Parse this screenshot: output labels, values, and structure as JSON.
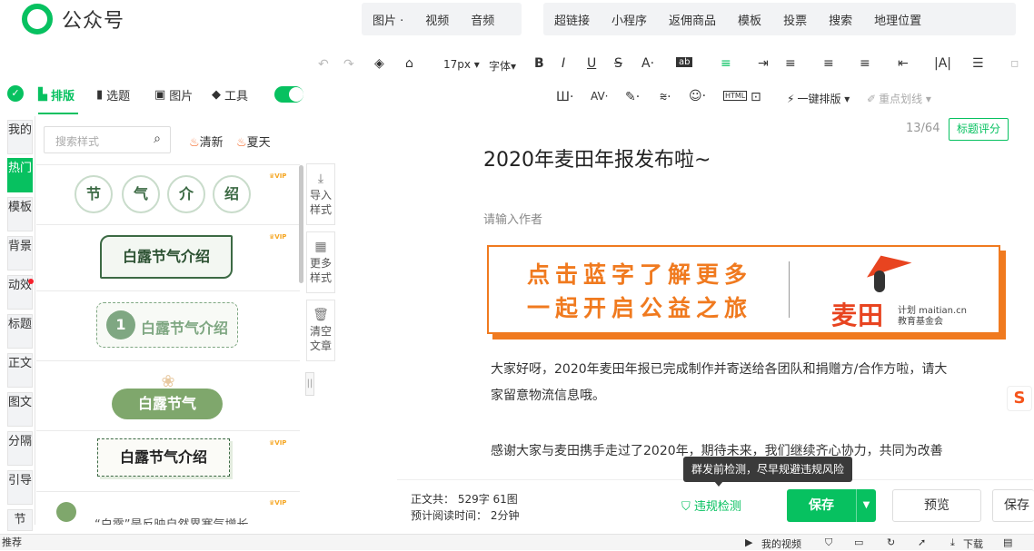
{
  "header": {
    "logo_text": "公众号",
    "menu_group1": [
      "图片 ·",
      "视频",
      "音频"
    ],
    "menu_group2": [
      "超链接",
      "小程序",
      "返佣商品",
      "模板",
      "投票",
      "搜索",
      "地理位置"
    ]
  },
  "toolbar": {
    "font_size": "17px ▾",
    "font_family": "字体▾",
    "one_click_layout": "一键排版 ▾",
    "highlight": "重点划线 ▾"
  },
  "plugin_tabs": [
    {
      "label": "排版",
      "active": true
    },
    {
      "label": "选题",
      "active": false
    },
    {
      "label": "图片",
      "active": false
    },
    {
      "label": "工具",
      "active": false
    }
  ],
  "vertical_tabs": [
    {
      "label": "我的",
      "active": false
    },
    {
      "label": "热门",
      "active": true
    },
    {
      "label": "模板",
      "active": false
    },
    {
      "label": "背景",
      "active": false
    },
    {
      "label": "动效",
      "active": false
    },
    {
      "label": "标题",
      "active": false
    },
    {
      "label": "正文",
      "active": false
    },
    {
      "label": "图文",
      "active": false
    },
    {
      "label": "分隔",
      "active": false
    },
    {
      "label": "引导",
      "active": false
    },
    {
      "label": "节",
      "active": false
    }
  ],
  "style_search": {
    "placeholder": "搜索样式",
    "tag1": "清新",
    "tag2": "夏天"
  },
  "styles": {
    "circles": [
      "节",
      "气",
      "介",
      "绍"
    ],
    "s2": "白露节气介绍",
    "s3_num": "1",
    "s3": "白露节气介绍",
    "s4": "白露节气",
    "s5": "白露节气介绍",
    "s6": "“白露”是反映自然界寒气增长",
    "vip": "VIP"
  },
  "side_buttons": {
    "import": "导入样式",
    "more": "更多样式",
    "clear": "清空文章"
  },
  "article": {
    "counter": "13/64",
    "score_btn": "标题评分",
    "title": "2020年麦田年报发布啦~",
    "author_placeholder": "请输入作者",
    "banner_line1": "点击蓝字了解更多",
    "banner_line2": "一起开启公益之旅",
    "brand_big": "麦田",
    "brand_sub1": "计划 maitian.cn",
    "brand_sub2": "教育基金会",
    "para1_line1": "大家好呀，2020年麦田年报已完成制作并寄送给各团队和捐赠方/合作方啦，请大",
    "para1_line2": "家留意物流信息哦。",
    "para2_line1": "感谢大家与麦田携手走过了2020年，期待未来，我们继续齐心协力，共同为改善"
  },
  "tooltip": "群发前检测，尽早规避违规风险",
  "bottom_bar": {
    "stats1": "正文共：  529字 61图",
    "stats2": "预计阅读时间：  2分钟",
    "check": "违规检测",
    "save": "保存",
    "preview": "预览",
    "save2": "保存"
  },
  "statusbar": {
    "left": "推荐",
    "video": "我的视频",
    "download": "下载"
  },
  "colors": {
    "brand_green": "#07c160",
    "banner_orange": "#f07a1f"
  }
}
